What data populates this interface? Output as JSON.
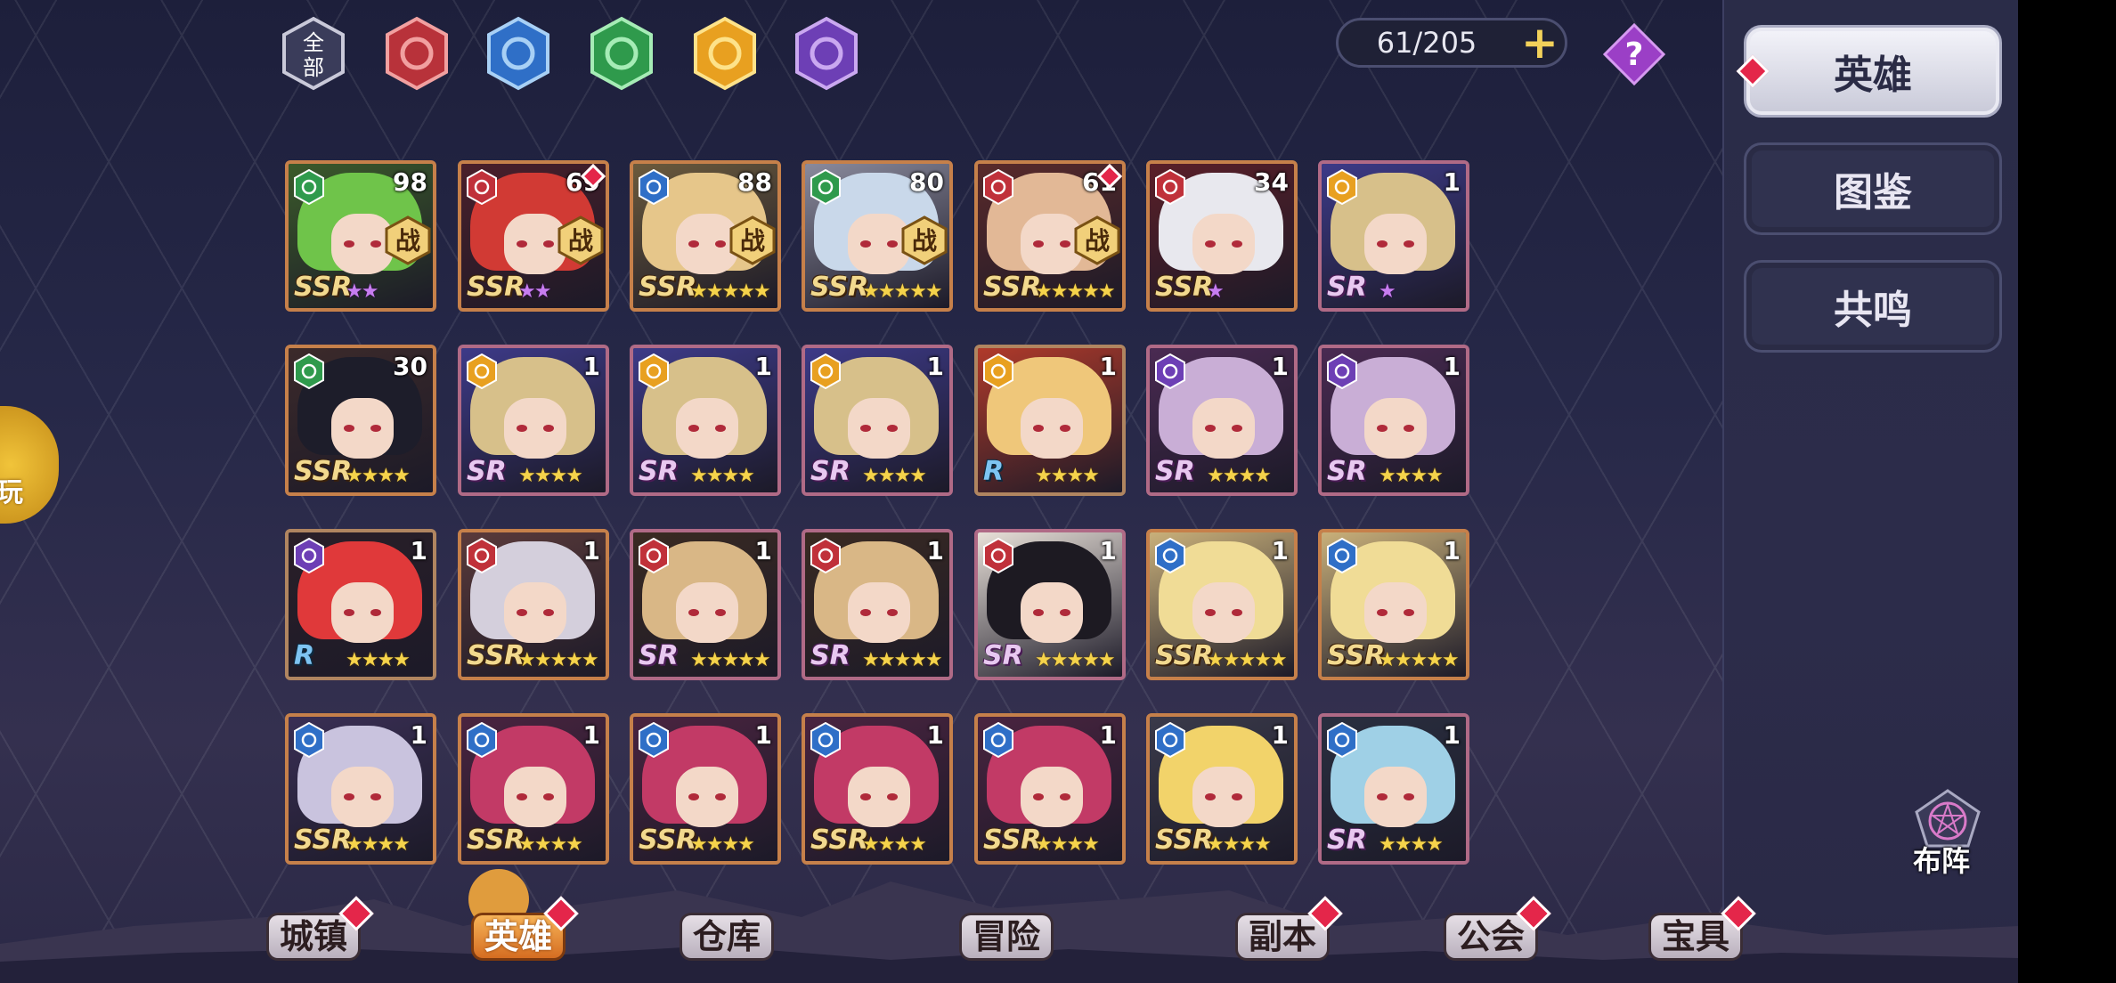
{
  "side_button": {
    "label": "玩"
  },
  "header": {
    "capacity": "61/205",
    "plus": "+"
  },
  "filters": [
    {
      "name": "all",
      "label": "全部",
      "color": "#3a3c5a",
      "stroke": "#c9c9d9"
    },
    {
      "name": "fire",
      "label": "",
      "color": "#b8323a",
      "stroke": "#f1a0a0"
    },
    {
      "name": "water",
      "label": "",
      "color": "#2f6fc7",
      "stroke": "#a8d0f5"
    },
    {
      "name": "wind",
      "label": "",
      "color": "#2f9a4c",
      "stroke": "#a6ecb6"
    },
    {
      "name": "light",
      "label": "",
      "color": "#e8a020",
      "stroke": "#fde28a"
    },
    {
      "name": "dark",
      "label": "",
      "color": "#6d3fb5",
      "stroke": "#caa8f0"
    }
  ],
  "side_tabs": [
    {
      "label": "英雄"
    },
    {
      "label": "图鉴"
    },
    {
      "label": "共鸣"
    }
  ],
  "formation": {
    "label": "布阵"
  },
  "element_colors": {
    "fire": "#c0313a",
    "water": "#2f6fc7",
    "wind": "#2f9a4c",
    "light": "#e8a020",
    "dark": "#6d3fb5"
  },
  "heroes": [
    {
      "element": "wind",
      "level": "98",
      "rarity": "SSR",
      "stars": "★★",
      "star_color": "purple",
      "battle": true,
      "red_mark": false,
      "hair": "#6fc44a",
      "bg": "#3b5a2a"
    },
    {
      "element": "fire",
      "level": "69",
      "rarity": "SSR",
      "stars": "★★",
      "star_color": "purple",
      "battle": true,
      "red_mark": true,
      "hair": "#d13a34",
      "bg": "#4a1f2a"
    },
    {
      "element": "water",
      "level": "88",
      "rarity": "SSR",
      "stars": "★★★★★",
      "star_color": "gold",
      "battle": true,
      "red_mark": false,
      "hair": "#e6c68a",
      "bg": "#6b5a3c"
    },
    {
      "element": "wind",
      "level": "80",
      "rarity": "SSR",
      "stars": "★★★★★",
      "star_color": "gold",
      "battle": true,
      "red_mark": false,
      "hair": "#c9d8ea",
      "bg": "#8a8a9c"
    },
    {
      "element": "fire",
      "level": "61",
      "rarity": "SSR",
      "stars": "★★★★★",
      "star_color": "gold",
      "battle": true,
      "red_mark": true,
      "hair": "#e2b896",
      "bg": "#5a2a2a"
    },
    {
      "element": "fire",
      "level": "34",
      "rarity": "SSR",
      "stars": "★",
      "star_color": "purple",
      "battle": false,
      "red_mark": false,
      "hair": "#e8e8ee",
      "bg": "#5a1f28"
    },
    {
      "element": "light",
      "level": "1",
      "rarity": "SR",
      "stars": "★",
      "star_color": "purple",
      "battle": false,
      "red_mark": false,
      "hair": "#d7c08a",
      "bg": "#3d3a88"
    },
    {
      "element": "wind",
      "level": "30",
      "rarity": "SSR",
      "stars": "★★★★",
      "star_color": "gold",
      "battle": false,
      "red_mark": false,
      "hair": "#1d1d2a",
      "bg": "#3c2a2a"
    },
    {
      "element": "light",
      "level": "1",
      "rarity": "SR",
      "stars": "★★★★",
      "star_color": "gold",
      "battle": false,
      "red_mark": false,
      "hair": "#d7c08a",
      "bg": "#3d3a88"
    },
    {
      "element": "light",
      "level": "1",
      "rarity": "SR",
      "stars": "★★★★",
      "star_color": "gold",
      "battle": false,
      "red_mark": false,
      "hair": "#d7c08a",
      "bg": "#3d3a88"
    },
    {
      "element": "light",
      "level": "1",
      "rarity": "SR",
      "stars": "★★★★",
      "star_color": "gold",
      "battle": false,
      "red_mark": false,
      "hair": "#d7c08a",
      "bg": "#3d3a88"
    },
    {
      "element": "light",
      "level": "1",
      "rarity": "R",
      "stars": "★★★★",
      "star_color": "gold",
      "battle": false,
      "red_mark": false,
      "hair": "#efc77a",
      "bg": "#b03a2a"
    },
    {
      "element": "dark",
      "level": "1",
      "rarity": "SR",
      "stars": "★★★★",
      "star_color": "gold",
      "battle": false,
      "red_mark": false,
      "hair": "#c9aed6",
      "bg": "#4a2a52"
    },
    {
      "element": "dark",
      "level": "1",
      "rarity": "SR",
      "stars": "★★★★",
      "star_color": "gold",
      "battle": false,
      "red_mark": false,
      "hair": "#c9aed6",
      "bg": "#4a2a52"
    },
    {
      "element": "dark",
      "level": "1",
      "rarity": "R",
      "stars": "★★★★",
      "star_color": "gold",
      "battle": false,
      "red_mark": false,
      "hair": "#e0393a",
      "bg": "#2a1f28"
    },
    {
      "element": "fire",
      "level": "1",
      "rarity": "SSR",
      "stars": "★★★★★",
      "star_color": "gold",
      "battle": false,
      "red_mark": false,
      "hair": "#d4cfdc",
      "bg": "#5a3a3a"
    },
    {
      "element": "fire",
      "level": "1",
      "rarity": "SR",
      "stars": "★★★★★",
      "star_color": "gold",
      "battle": false,
      "red_mark": false,
      "hair": "#d9b786",
      "bg": "#3a2a22"
    },
    {
      "element": "fire",
      "level": "1",
      "rarity": "SR",
      "stars": "★★★★★",
      "star_color": "gold",
      "battle": false,
      "red_mark": false,
      "hair": "#d9b786",
      "bg": "#3a2a22"
    },
    {
      "element": "fire",
      "level": "1",
      "rarity": "SR",
      "stars": "★★★★★",
      "star_color": "gold",
      "battle": false,
      "red_mark": false,
      "hair": "#1d1a22",
      "bg": "#e8e0d8"
    },
    {
      "element": "water",
      "level": "1",
      "rarity": "SSR",
      "stars": "★★★★★",
      "star_color": "gold",
      "battle": false,
      "red_mark": false,
      "hair": "#f0dc96",
      "bg": "#c9b07a"
    },
    {
      "element": "water",
      "level": "1",
      "rarity": "SSR",
      "stars": "★★★★★",
      "star_color": "gold",
      "battle": false,
      "red_mark": false,
      "hair": "#f0dc96",
      "bg": "#c9b07a"
    },
    {
      "element": "water",
      "level": "1",
      "rarity": "SSR",
      "stars": "★★★★",
      "star_color": "gold",
      "battle": false,
      "red_mark": false,
      "hair": "#c9c3de",
      "bg": "#3a2f55"
    },
    {
      "element": "water",
      "level": "1",
      "rarity": "SSR",
      "stars": "★★★★",
      "star_color": "gold",
      "battle": false,
      "red_mark": false,
      "hair": "#c23a66",
      "bg": "#4a2440"
    },
    {
      "element": "water",
      "level": "1",
      "rarity": "SSR",
      "stars": "★★★★",
      "star_color": "gold",
      "battle": false,
      "red_mark": false,
      "hair": "#c23a66",
      "bg": "#4a2440"
    },
    {
      "element": "water",
      "level": "1",
      "rarity": "SSR",
      "stars": "★★★★",
      "star_color": "gold",
      "battle": false,
      "red_mark": false,
      "hair": "#c23a66",
      "bg": "#4a2440"
    },
    {
      "element": "water",
      "level": "1",
      "rarity": "SSR",
      "stars": "★★★★",
      "star_color": "gold",
      "battle": false,
      "red_mark": false,
      "hair": "#c23a66",
      "bg": "#4a2440"
    },
    {
      "element": "water",
      "level": "1",
      "rarity": "SSR",
      "stars": "★★★★",
      "star_color": "gold",
      "battle": false,
      "red_mark": false,
      "hair": "#f2d36a",
      "bg": "#3a3a4a"
    },
    {
      "element": "water",
      "level": "1",
      "rarity": "SR",
      "stars": "★★★★",
      "star_color": "gold",
      "battle": false,
      "red_mark": false,
      "hair": "#9fd0e6",
      "bg": "#2a2f40"
    }
  ],
  "battle_label": "战",
  "nav": [
    {
      "name": "town",
      "label": "城镇",
      "active": false,
      "dot": true
    },
    {
      "name": "heroes",
      "label": "英雄",
      "active": true,
      "dot": true
    },
    {
      "name": "warehouse",
      "label": "仓库",
      "active": false,
      "dot": false
    },
    {
      "name": "adventure",
      "label": "冒险",
      "active": false,
      "dot": false
    },
    {
      "name": "dungeon",
      "label": "副本",
      "active": false,
      "dot": true
    },
    {
      "name": "guild",
      "label": "公会",
      "active": false,
      "dot": true
    },
    {
      "name": "treasure",
      "label": "宝具",
      "active": false,
      "dot": true
    }
  ]
}
